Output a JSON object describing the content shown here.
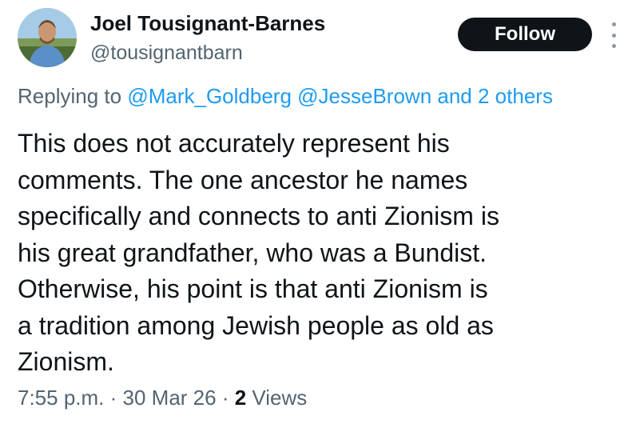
{
  "author": {
    "display_name": "Joel Tousignant-Barnes",
    "handle": "@tousignantbarn"
  },
  "follow_button": {
    "label": "Follow"
  },
  "more_icon": "more-vertical-icon",
  "reply": {
    "prefix": "Replying to ",
    "mentions": [
      "@Mark_Goldberg",
      "@JesseBrown"
    ],
    "others_text": "and 2 others"
  },
  "tweet": {
    "lines": [
      "This does not accurately represent his",
      "comments. The one ancestor he names",
      "specifically and connects to anti Zionism is",
      "his great grandfather, who was a Bundist.",
      "Otherwise, his point is that anti Zionism is",
      "a tradition among Jewish people as old as",
      "Zionism."
    ]
  },
  "meta": {
    "time": "7:55 p.m.",
    "separator": " · ",
    "date": "30 Mar 26",
    "views_count": "2",
    "views_label": " Views"
  },
  "colors": {
    "text_primary": "#0f1419",
    "text_secondary": "#536471",
    "link": "#1d9bf0",
    "follow_bg": "#0f1419"
  }
}
